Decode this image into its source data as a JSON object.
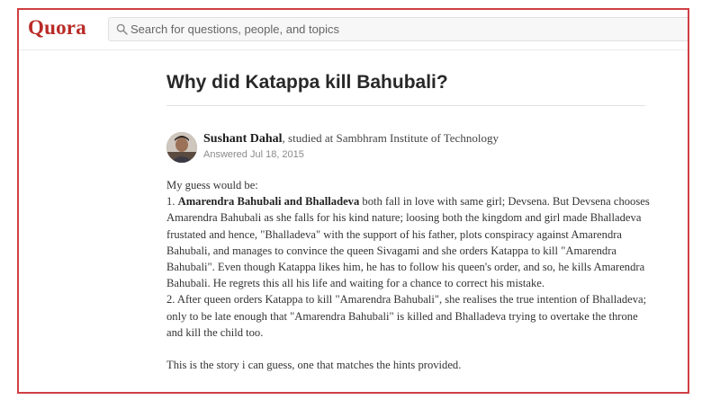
{
  "header": {
    "logo_text": "Quora",
    "search_placeholder": "Search for questions, people, and topics"
  },
  "question": {
    "title": "Why did Katappa kill Bahubali?"
  },
  "answer": {
    "author_name": "Sushant Dahal",
    "credential": ", studied at Sambhram Institute of Technology",
    "answered_date": "Answered Jul 18, 2015",
    "intro": "My guess would be:",
    "point1_prefix": "1. ",
    "point1_bold": "Amarendra Bahubali and Bhalladeva",
    "point1_rest": " both fall in love with same girl; Devsena. But Devsena chooses Amarendra Bahubali as she falls for his kind nature; loosing both the kingdom and girl made Bhalladeva frustated and hence, \"Bhalladeva\" with the support of his father, plots conspiracy against Amarendra Bahubali, and manages to convince the queen Sivagami and she orders Katappa to kill \"Amarendra Bahubali\". Even though Katappa likes him, he has to follow his queen's order, and so, he kills Amarendra Bahubali. He regrets this all his life and waiting for a chance to correct his mistake.",
    "point2": "2. After queen orders Katappa to kill \"Amarendra Bahubali\", she realises the true intention of Bhalladeva; only to be late enough that \"Amarendra Bahubali\" is killed and Bhalladeva trying to overtake the throne and kill the child too.",
    "closing": "This is the story i can guess, one that matches the hints provided."
  },
  "colors": {
    "brand": "#b92b27",
    "frame_border": "#cf3f44"
  },
  "icons": {
    "search": "search-icon",
    "avatar": "avatar"
  }
}
